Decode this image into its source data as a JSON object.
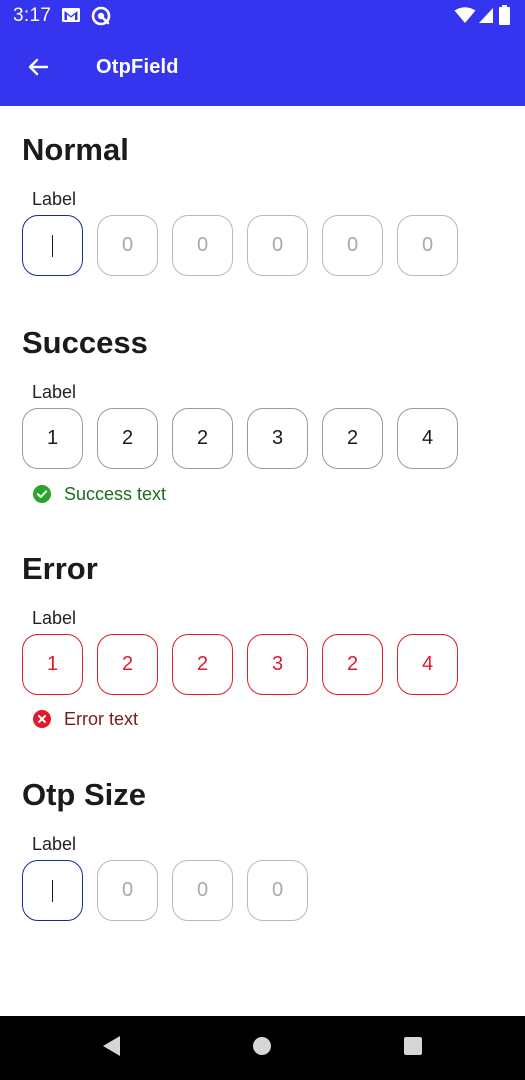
{
  "status_bar": {
    "time": "3:17",
    "left_icons": [
      "gmail-icon",
      "sync-icon"
    ],
    "right_icons": [
      "wifi-icon",
      "signal-icon",
      "battery-icon"
    ]
  },
  "app_bar": {
    "title": "OtpField",
    "back_icon": "arrow-back-icon"
  },
  "sections": {
    "normal": {
      "title": "Normal",
      "label": "Label",
      "digits": [
        "",
        "0",
        "0",
        "0",
        "0",
        "0"
      ]
    },
    "success": {
      "title": "Success",
      "label": "Label",
      "digits": [
        "1",
        "2",
        "2",
        "3",
        "2",
        "4"
      ],
      "helper_text": "Success text"
    },
    "error": {
      "title": "Error",
      "label": "Label",
      "digits": [
        "1",
        "2",
        "2",
        "3",
        "2",
        "4"
      ],
      "helper_text": "Error text"
    },
    "otp_size": {
      "title": "Otp Size",
      "label": "Label",
      "digits": [
        "",
        "0",
        "0",
        "0"
      ]
    }
  },
  "colors": {
    "primary": "#3535f0",
    "focus_border": "#1a2a9c",
    "error": "#e01a2b",
    "success_icon": "#2aa52a"
  },
  "nav_bar": {
    "icons": [
      "back-triangle-icon",
      "home-circle-icon",
      "recents-square-icon"
    ]
  }
}
